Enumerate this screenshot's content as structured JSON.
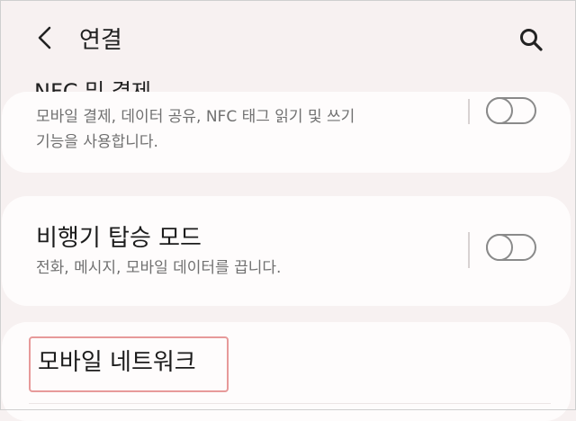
{
  "header": {
    "title": "연결"
  },
  "items": [
    {
      "title": "NFC 및 결제",
      "subtitle_line1": "모바일 결제, 데이터 공유, NFC 태그 읽기 및 쓰기",
      "subtitle_line2": "기능을 사용합니다.",
      "toggle_on": false
    },
    {
      "title": "비행기 탑승 모드",
      "subtitle": "전화, 메시지, 모바일 데이터를 끕니다.",
      "toggle_on": false
    },
    {
      "title": "모바일 네트워크"
    }
  ]
}
